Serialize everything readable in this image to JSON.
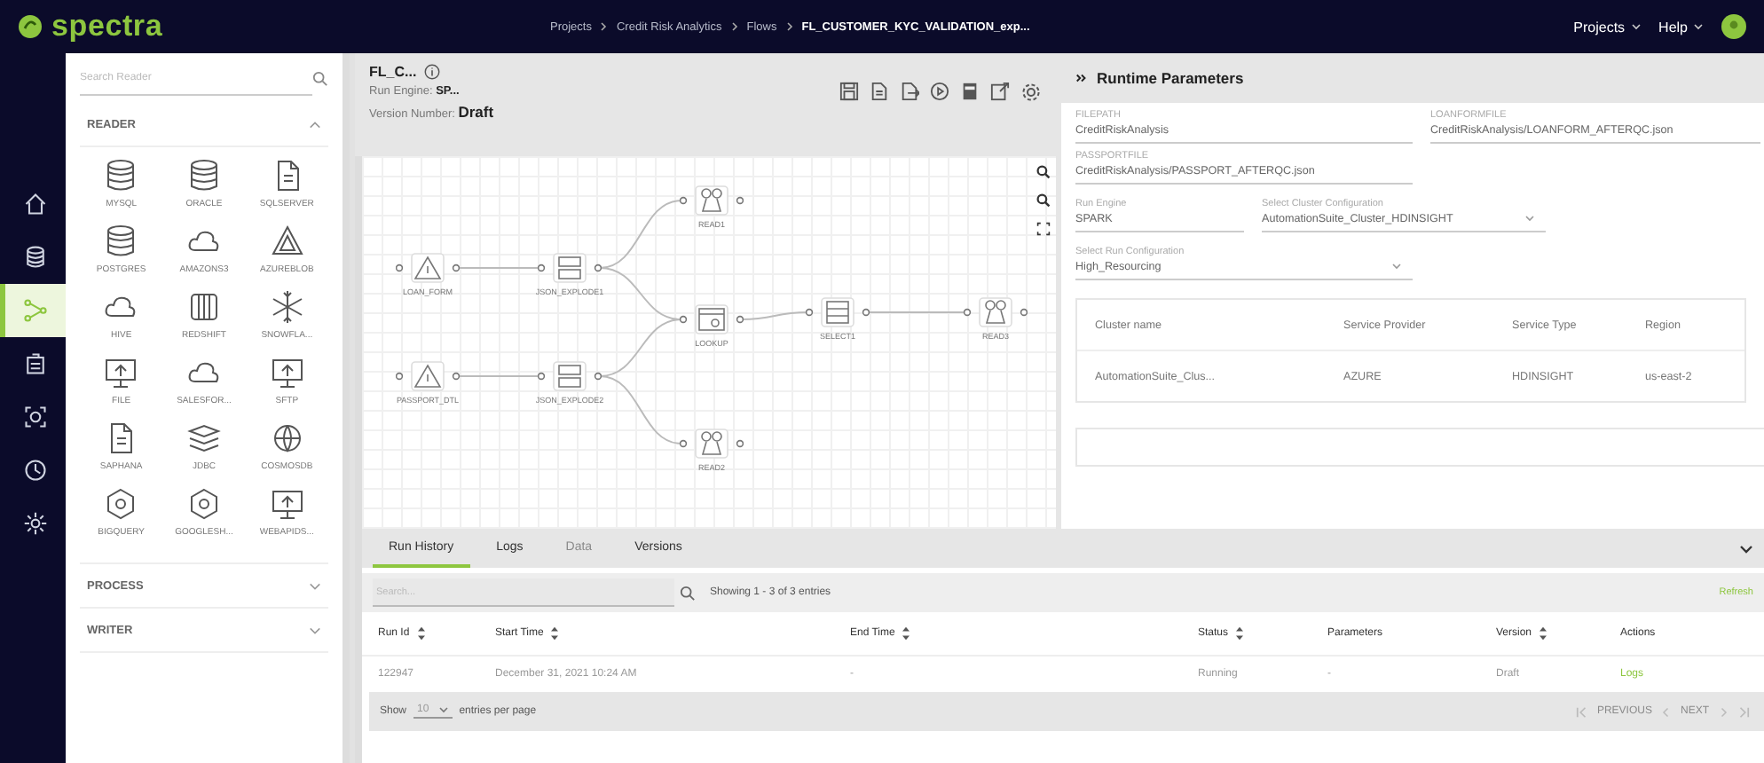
{
  "topbar": {
    "logo": "spectra",
    "breadcrumb": [
      "Projects",
      "Credit Risk Analytics",
      "Flows",
      "FL_CUSTOMER_KYC_VALIDATION_exp..."
    ],
    "menus": [
      "Projects",
      "Help"
    ]
  },
  "rail": [
    {
      "selected": false
    },
    {
      "selected": false
    },
    {
      "selected": true
    },
    {
      "selected": false
    },
    {
      "selected": false
    },
    {
      "selected": false
    },
    {
      "selected": false
    }
  ],
  "palette": {
    "search": {
      "placeholder": "Search Reader"
    },
    "sections": [
      {
        "title": "READER",
        "expanded": true,
        "items": [
          "MYSQL",
          "ORACLE",
          "SQLSERVER",
          "POSTGRES",
          "AMAZONS3",
          "AZUREBLOB",
          "HIVE",
          "REDSHIFT",
          "SNOWFLA...",
          "FILE",
          "SALESFOR...",
          "SFTP",
          "SAPHANA",
          "JDBC",
          "COSMOSDB",
          "BIGQUERY",
          "GOOGLESH...",
          "WEBAPIDS..."
        ]
      },
      {
        "title": "PROCESS",
        "expanded": false
      },
      {
        "title": "WRITER",
        "expanded": false
      }
    ]
  },
  "flow": {
    "title": "FL_C...",
    "run_engine": "Run Engine: **SP...**",
    "version": "Version Number: **Draft**",
    "nodes": [
      {
        "label": "LOAN_FORM",
        "kind": "source"
      },
      {
        "label": "JSON_EXPLODE1",
        "kind": "explode"
      },
      {
        "label": "READ1",
        "kind": "read"
      },
      {
        "label": "LOOKUP",
        "kind": "lookup"
      },
      {
        "label": "SELECT1",
        "kind": "select"
      },
      {
        "label": "READ3",
        "kind": "read"
      },
      {
        "label": "PASSPORT_DTL",
        "kind": "source"
      },
      {
        "label": "JSON_EXPLODE2",
        "kind": "explode"
      },
      {
        "label": "READ2",
        "kind": "read"
      }
    ]
  },
  "runtime": {
    "title": "Runtime Parameters",
    "fields": [
      {
        "kind": "text",
        "label": "FILEPATH",
        "value": "CreditRiskAnalysis"
      },
      {
        "kind": "text",
        "label": "LOANFORMFILE",
        "value": "CreditRiskAnalysis/LOANFORM_AFTERQC.json"
      },
      {
        "kind": "text",
        "label": "PASSPORTFILE",
        "value": "CreditRiskAnalysis/PASSPORT_AFTERQC.json"
      },
      {
        "kind": "text",
        "label": "Run Engine",
        "value": "SPARK"
      },
      {
        "kind": "select",
        "label": "Select Cluster Configuration",
        "value": "AutomationSuite_Cluster_HDINSIGHT"
      },
      {
        "kind": "select",
        "label": "Select Run Configuration",
        "value": "High_Resourcing"
      }
    ],
    "cluster_table": {
      "columns": [
        "Cluster name",
        "Service Provider",
        "Service Type",
        "Region"
      ],
      "rows": [
        [
          "AutomationSuite_Clus...",
          "AZURE",
          "HDINSIGHT",
          "us-east-2"
        ]
      ]
    }
  },
  "bottom": {
    "tabs": [
      {
        "label": "Run History",
        "selected": true,
        "disabled": false
      },
      {
        "label": "Logs",
        "selected": false,
        "disabled": false
      },
      {
        "label": "Data",
        "selected": false,
        "disabled": true
      },
      {
        "label": "Versions",
        "selected": false,
        "disabled": false
      }
    ],
    "search": {
      "placeholder": "Search..."
    },
    "summary": "Showing 1 - 3 of 3 entries",
    "refresh": "Refresh",
    "columns": [
      {
        "label": "Run Id",
        "sortable": true
      },
      {
        "label": "Start Time",
        "sortable": true
      },
      {
        "label": "End Time",
        "sortable": true
      },
      {
        "label": "Status",
        "sortable": true
      },
      {
        "label": "Parameters",
        "sortable": false
      },
      {
        "label": "Version",
        "sortable": true
      },
      {
        "label": "Actions",
        "sortable": false
      }
    ],
    "rows": [
      {
        "cells": [
          "122947",
          "December 31, 2021 10:24 AM",
          "-",
          "Running",
          "-",
          "Draft"
        ],
        "action": "Logs"
      }
    ],
    "footer": {
      "show": "Show",
      "page_size": "10",
      "suffix": "entries per page",
      "previous": "PREVIOUS",
      "next": "NEXT"
    }
  }
}
